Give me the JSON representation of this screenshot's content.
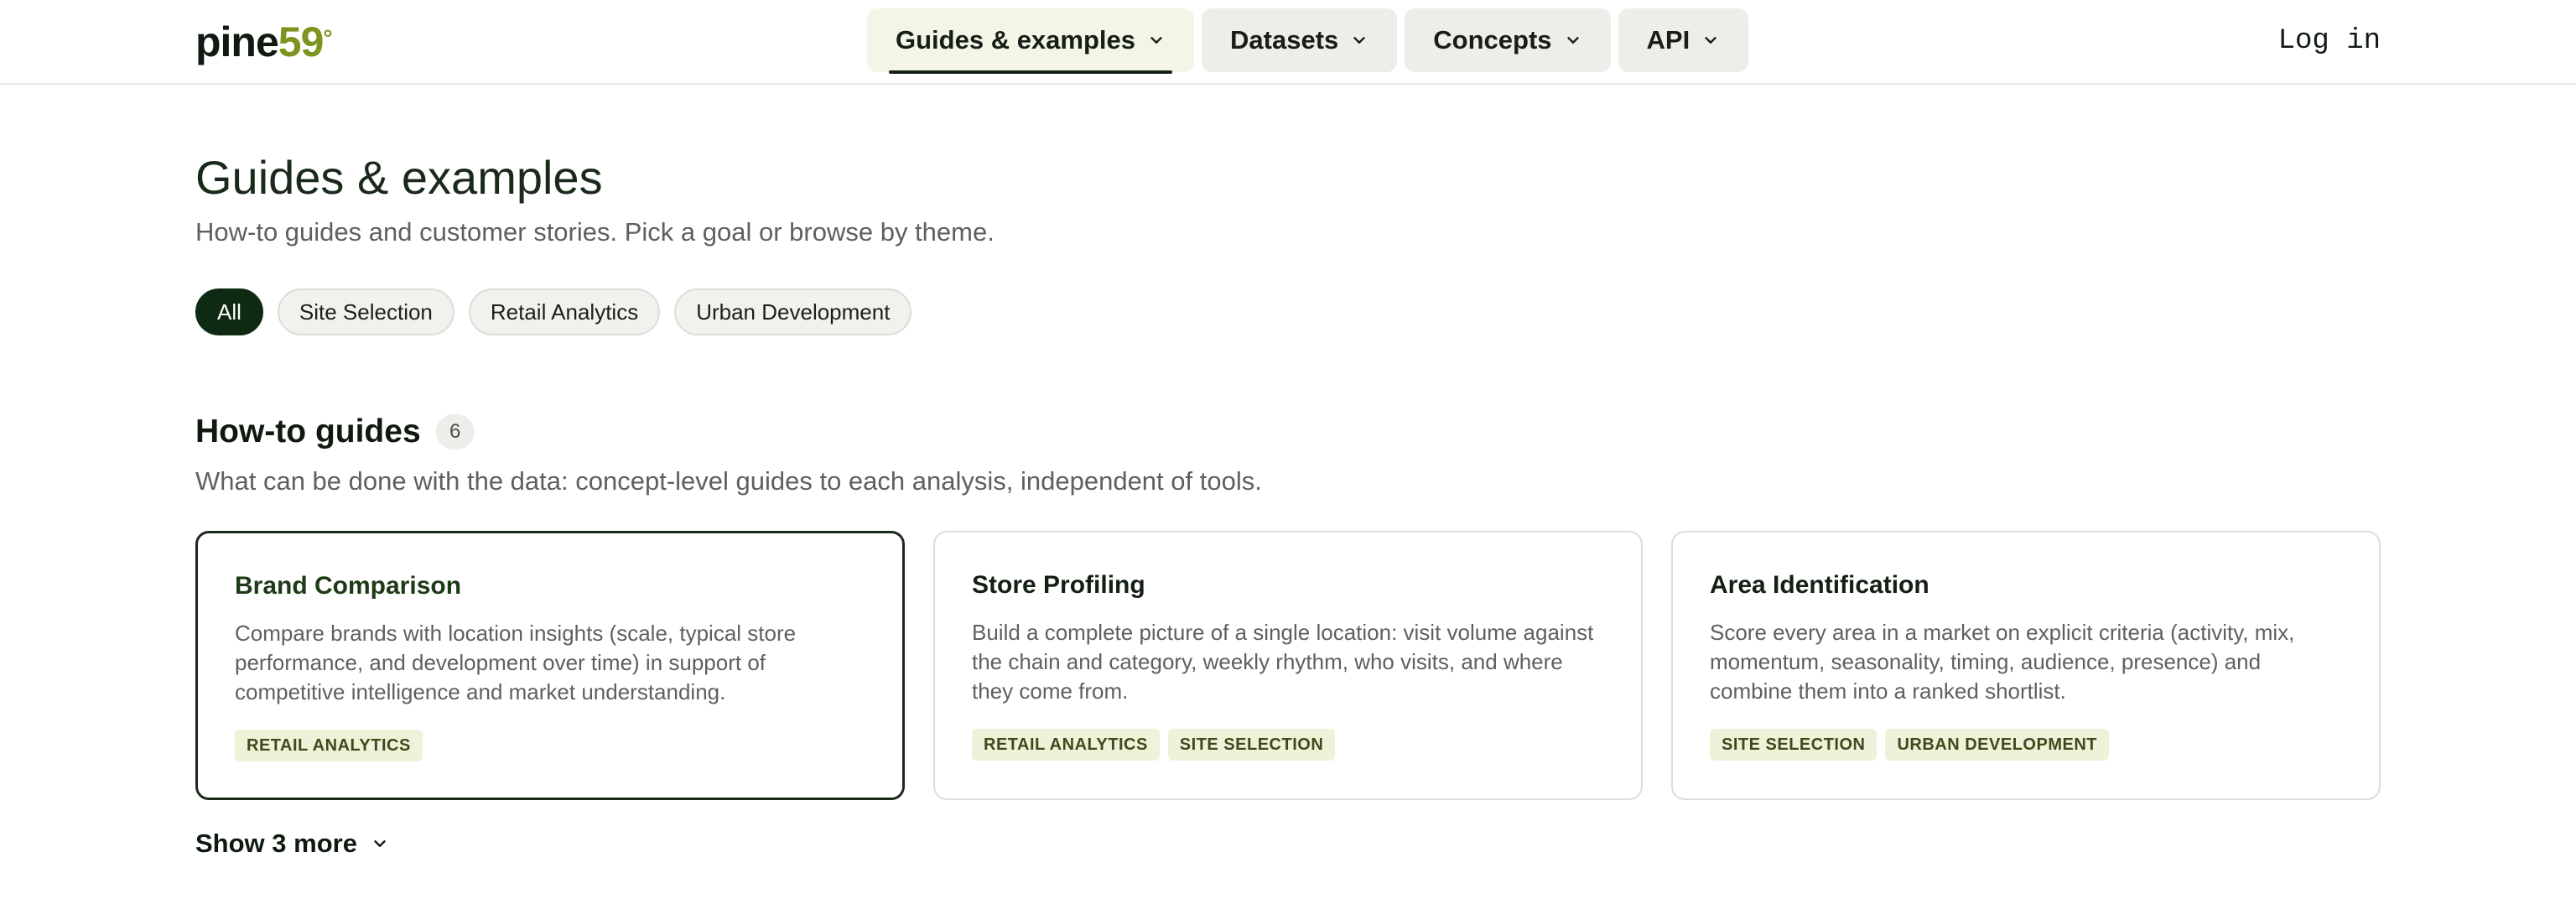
{
  "header": {
    "logo": {
      "word": "pine",
      "number": "59",
      "degree": "°"
    },
    "nav": [
      {
        "label": "Guides & examples",
        "active": true
      },
      {
        "label": "Datasets",
        "active": false
      },
      {
        "label": "Concepts",
        "active": false
      },
      {
        "label": "API",
        "active": false
      }
    ],
    "login_label": "Log in"
  },
  "main": {
    "title": "Guides & examples",
    "subtitle": "How-to guides and customer stories. Pick a goal or browse by theme.",
    "filters": [
      {
        "label": "All",
        "active": true
      },
      {
        "label": "Site Selection",
        "active": false
      },
      {
        "label": "Retail Analytics",
        "active": false
      },
      {
        "label": "Urban Development",
        "active": false
      }
    ],
    "section": {
      "title": "How-to guides",
      "count": "6",
      "description": "What can be done with the data: concept-level guides to each analysis, independent of tools."
    },
    "cards": [
      {
        "title": "Brand Comparison",
        "description": "Compare brands with location insights (scale, typical store performance, and development over time) in support of competitive intelligence and market understanding.",
        "tags": [
          "RETAIL ANALYTICS"
        ],
        "selected": true
      },
      {
        "title": "Store Profiling",
        "description": "Build a complete picture of a single location: visit volume against the chain and category, weekly rhythm, who visits, and where they come from.",
        "tags": [
          "RETAIL ANALYTICS",
          "SITE SELECTION"
        ],
        "selected": false
      },
      {
        "title": "Area Identification",
        "description": "Score every area in a market on explicit criteria (activity, mix, momentum, seasonality, timing, audience, presence) and combine them into a ranked shortlist.",
        "tags": [
          "SITE SELECTION",
          "URBAN DEVELOPMENT"
        ],
        "selected": false
      }
    ],
    "show_more_label": "Show 3 more"
  },
  "colors": {
    "brand_dark": "#0f2a12",
    "brand_accent": "#7d951f",
    "tag_bg": "#eef2d9",
    "nav_active_bg": "#f3f6e6"
  },
  "icons": {
    "nav_dropdown": "chevron-down-icon",
    "show_more": "chevron-down-icon"
  }
}
